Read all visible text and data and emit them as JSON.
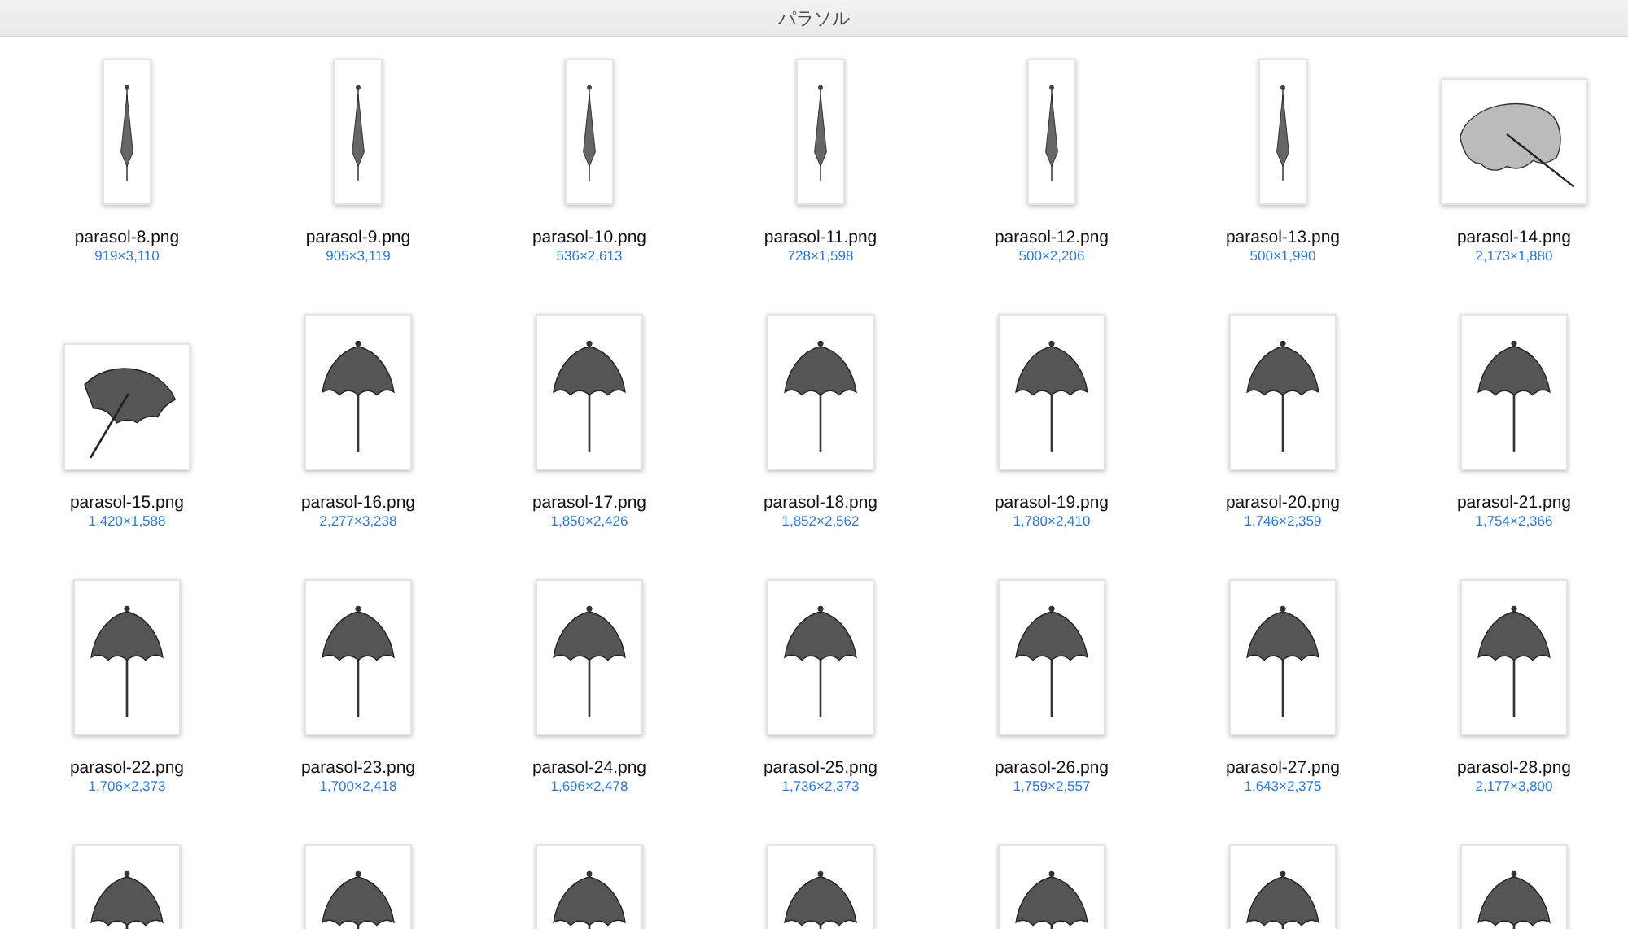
{
  "window": {
    "title": "パラソル"
  },
  "files": [
    {
      "name": "parasol-8.png",
      "dimensions": "919×3,110",
      "kind": "closed"
    },
    {
      "name": "parasol-9.png",
      "dimensions": "905×3,119",
      "kind": "closed"
    },
    {
      "name": "parasol-10.png",
      "dimensions": "536×2,613",
      "kind": "closed"
    },
    {
      "name": "parasol-11.png",
      "dimensions": "728×1,598",
      "kind": "closed"
    },
    {
      "name": "parasol-12.png",
      "dimensions": "500×2,206",
      "kind": "closed"
    },
    {
      "name": "parasol-13.png",
      "dimensions": "500×1,990",
      "kind": "closed"
    },
    {
      "name": "parasol-14.png",
      "dimensions": "2,173×1,880",
      "kind": "wide"
    },
    {
      "name": "parasol-15.png",
      "dimensions": "1,420×1,588",
      "kind": "tilted"
    },
    {
      "name": "parasol-16.png",
      "dimensions": "2,277×3,238",
      "kind": "open"
    },
    {
      "name": "parasol-17.png",
      "dimensions": "1,850×2,426",
      "kind": "open"
    },
    {
      "name": "parasol-18.png",
      "dimensions": "1,852×2,562",
      "kind": "open"
    },
    {
      "name": "parasol-19.png",
      "dimensions": "1,780×2,410",
      "kind": "open"
    },
    {
      "name": "parasol-20.png",
      "dimensions": "1,746×2,359",
      "kind": "open"
    },
    {
      "name": "parasol-21.png",
      "dimensions": "1,754×2,366",
      "kind": "open"
    },
    {
      "name": "parasol-22.png",
      "dimensions": "1,706×2,373",
      "kind": "open"
    },
    {
      "name": "parasol-23.png",
      "dimensions": "1,700×2,418",
      "kind": "open"
    },
    {
      "name": "parasol-24.png",
      "dimensions": "1,696×2,478",
      "kind": "open"
    },
    {
      "name": "parasol-25.png",
      "dimensions": "1,736×2,373",
      "kind": "open"
    },
    {
      "name": "parasol-26.png",
      "dimensions": "1,759×2,557",
      "kind": "open"
    },
    {
      "name": "parasol-27.png",
      "dimensions": "1,643×2,375",
      "kind": "open"
    },
    {
      "name": "parasol-28.png",
      "dimensions": "2,177×3,800",
      "kind": "open"
    },
    {
      "kind": "open"
    },
    {
      "kind": "open"
    },
    {
      "kind": "open"
    },
    {
      "kind": "open"
    },
    {
      "kind": "open"
    },
    {
      "kind": "open"
    },
    {
      "kind": "open"
    }
  ]
}
